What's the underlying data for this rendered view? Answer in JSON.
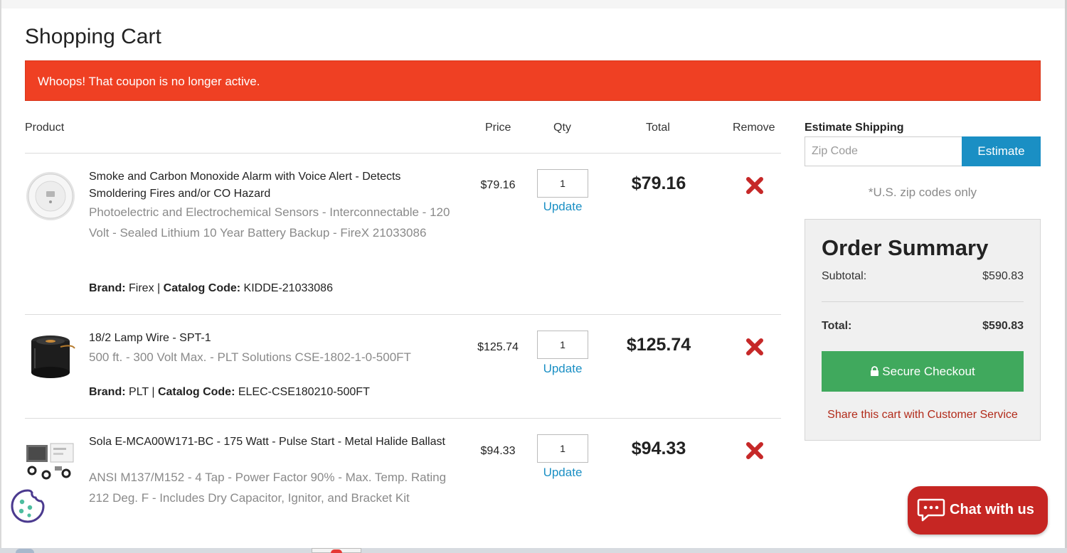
{
  "page": {
    "title": "Shopping Cart",
    "alert": "Whoops! That coupon is no longer active."
  },
  "table": {
    "headers": {
      "product": "Product",
      "price": "Price",
      "qty": "Qty",
      "total": "Total",
      "remove": "Remove"
    },
    "update_label": "Update",
    "brand_label": "Brand:",
    "catalog_label": "Catalog Code:",
    "separator": "|"
  },
  "items": [
    {
      "title": "Smoke and Carbon Monoxide Alarm with Voice Alert - Detects Smoldering Fires and/or CO Hazard",
      "description": "Photoelectric and Electrochemical Sensors - Interconnectable - 120 Volt - Sealed Lithium 10 Year Battery Backup - FireX 21033086",
      "brand": "Firex",
      "catalog_code": "KIDDE-21033086",
      "price": "$79.16",
      "qty": "1",
      "total": "$79.16",
      "thumb_icon": "smoke-alarm-icon"
    },
    {
      "title": "18/2 Lamp Wire - SPT-1",
      "description": "500 ft. - 300 Volt Max. - PLT Solutions CSE-1802-1-0-500FT",
      "brand": "PLT",
      "catalog_code": "ELEC-CSE180210-500FT",
      "price": "$125.74",
      "qty": "1",
      "total": "$125.74",
      "thumb_icon": "wire-spool-icon"
    },
    {
      "title": "Sola E-MCA00W171-BC - 175 Watt - Pulse Start - Metal Halide Ballast",
      "description": "ANSI M137/M152 - 4 Tap - Power Factor 90% - Max. Temp. Rating 212 Deg. F - Includes Dry Capacitor, Ignitor, and Bracket Kit",
      "price": "$94.33",
      "qty": "1",
      "total": "$94.33",
      "thumb_icon": "ballast-kit-icon"
    }
  ],
  "shipping": {
    "label": "Estimate Shipping",
    "zip_placeholder": "Zip Code",
    "zip_value": "",
    "button": "Estimate",
    "note": "*U.S. zip codes only"
  },
  "summary": {
    "title": "Order Summary",
    "subtotal_label": "Subtotal:",
    "subtotal": "$590.83",
    "total_label": "Total:",
    "total": "$590.83",
    "checkout": "Secure Checkout",
    "share": "Share this cart with Customer Service"
  },
  "chat": {
    "label": "Chat with us"
  },
  "colors": {
    "alert": "#ef4023",
    "link": "#1a8fc4",
    "checkout": "#40a95d",
    "remove": "#c62828",
    "chat": "#c62623",
    "share": "#b22b1a"
  }
}
